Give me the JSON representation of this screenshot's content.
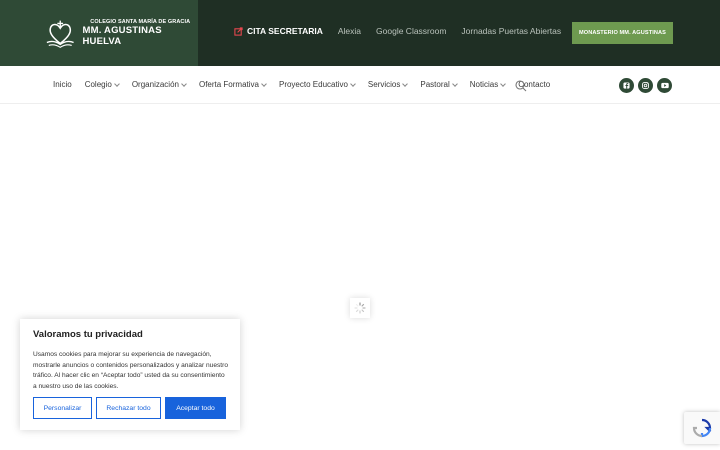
{
  "header": {
    "logo": {
      "line1": "COLEGIO SANTA MARÍA DE GRACIA",
      "line2": "MM. AGUSTINAS HUELVA"
    },
    "top_links": [
      {
        "label": "CITA SECRETARIA",
        "icon": "external-edit-icon"
      },
      {
        "label": "Alexia"
      },
      {
        "label": "Google Classroom"
      },
      {
        "label": "Jornadas Puertas Abiertas"
      }
    ],
    "monasterio_button": "MONASTERIO MM. AGUSTINAS"
  },
  "nav": {
    "items": [
      {
        "label": "Inicio",
        "dropdown": false
      },
      {
        "label": "Colegio",
        "dropdown": true
      },
      {
        "label": "Organización",
        "dropdown": true
      },
      {
        "label": "Oferta Formativa",
        "dropdown": true
      },
      {
        "label": "Proyecto Educativo",
        "dropdown": true
      },
      {
        "label": "Servicios",
        "dropdown": true
      },
      {
        "label": "Pastoral",
        "dropdown": true
      },
      {
        "label": "Noticias",
        "dropdown": true
      },
      {
        "label": "Contacto",
        "dropdown": false
      }
    ],
    "search_icon": "search-icon",
    "socials": [
      "facebook-icon",
      "instagram-icon",
      "youtube-icon"
    ]
  },
  "cookie_banner": {
    "title": "Valoramos tu privacidad",
    "text": "Usamos cookies para mejorar su experiencia de navegación, mostrarle anuncios o contenidos personalizados y analizar nuestro tráfico. Al hacer clic en “Aceptar todo” usted da su consentimiento a nuestro uso de las cookies.",
    "buttons": {
      "customize": "Personalizar",
      "reject": "Rechazar todo",
      "accept": "Aceptar todo"
    }
  },
  "colors": {
    "topbar": "#1f2f24",
    "logo_block": "#2f4a36",
    "accent_green": "#6e9a50",
    "cookie_blue": "#1863dc"
  }
}
